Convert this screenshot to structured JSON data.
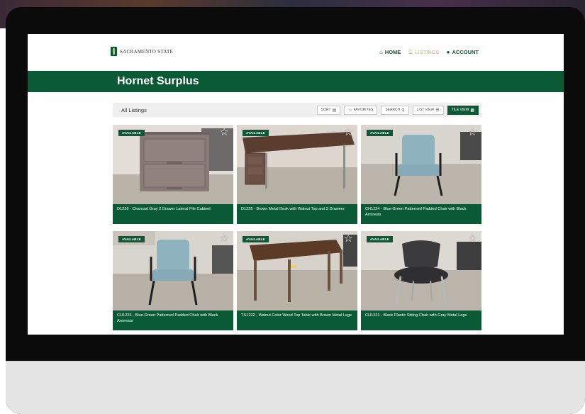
{
  "nav": {
    "logo_text": "SACRAMENTO STATE",
    "links": [
      {
        "label": "HOME",
        "icon": "home-icon",
        "glyph": "⌂"
      },
      {
        "label": "LISTINGS",
        "icon": "list-icon",
        "glyph": "☰"
      },
      {
        "label": "ACCOUNT",
        "icon": "user-icon",
        "glyph": "●"
      }
    ]
  },
  "banner": {
    "title": "Hornet Surplus"
  },
  "toolbar": {
    "title": "All Listings",
    "buttons": [
      {
        "label": "SORT",
        "glyph": "▤"
      },
      {
        "label": "FAVORITES",
        "glyph": "☆"
      },
      {
        "label": "SEARCH",
        "glyph": "⚲"
      },
      {
        "label": "LIST VIEW",
        "glyph": "☰"
      },
      {
        "label": "TILE VIEW",
        "glyph": "▦"
      }
    ]
  },
  "listings": [
    {
      "badge": "AVAILABLE",
      "caption": "D1226 - Charcoal Gray 2 Drawer Lateral File Cabinet"
    },
    {
      "badge": "AVAILABLE",
      "caption": "D1225 - Brown Metal Desk with Walnut Top and 3 Drawers"
    },
    {
      "badge": "AVAILABLE",
      "caption": "CH1224 - Blue-Green Patterned Padded Chair with Black Armrests"
    },
    {
      "badge": "AVAILABLE",
      "caption": "CH1223 - Blue-Green Patterned Padded Chair with Black Armrests"
    },
    {
      "badge": "AVAILABLE",
      "caption": "TS1222 - Walnut Color Wood Top Table with Brown Metal Legs"
    },
    {
      "badge": "AVAILABLE",
      "caption": "CH1221 - Black Plastic Sitting Chair with Gray Metal Legs"
    }
  ],
  "colors": {
    "brand_green": "#0b5a36",
    "brand_gold": "#c4b581"
  }
}
